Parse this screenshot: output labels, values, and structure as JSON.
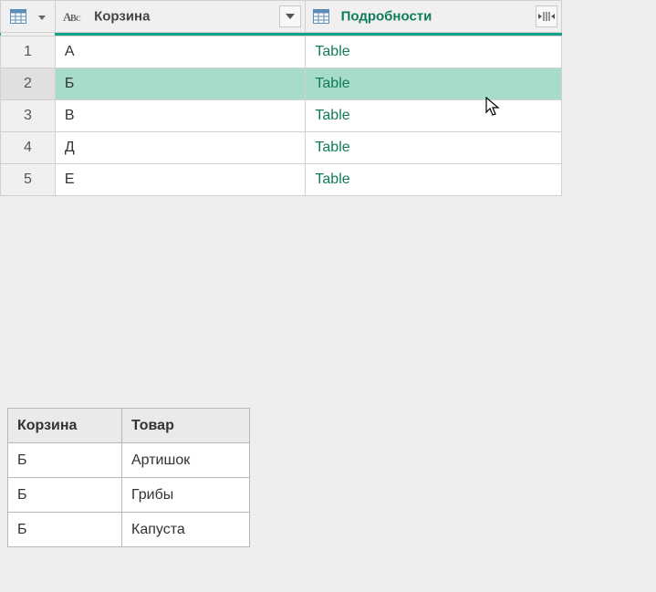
{
  "mainTable": {
    "columns": {
      "a": "Корзина",
      "b": "Подробности"
    },
    "rows": [
      {
        "num": "1",
        "a": "А",
        "b": "Table",
        "selected": false
      },
      {
        "num": "2",
        "a": "Б",
        "b": "Table",
        "selected": true
      },
      {
        "num": "3",
        "a": "В",
        "b": "Table",
        "selected": false
      },
      {
        "num": "4",
        "a": "Д",
        "b": "Table",
        "selected": false
      },
      {
        "num": "5",
        "a": "Е",
        "b": "Table",
        "selected": false
      }
    ]
  },
  "previewTable": {
    "columns": {
      "a": "Корзина",
      "b": "Товар"
    },
    "rows": [
      {
        "a": "Б",
        "b": "Артишок"
      },
      {
        "a": "Б",
        "b": "Грибы"
      },
      {
        "a": "Б",
        "b": "Капуста"
      }
    ]
  },
  "colors": {
    "accent": "#12a187",
    "link": "#0f7b5b",
    "selectedRow": "#a6dcc9"
  }
}
